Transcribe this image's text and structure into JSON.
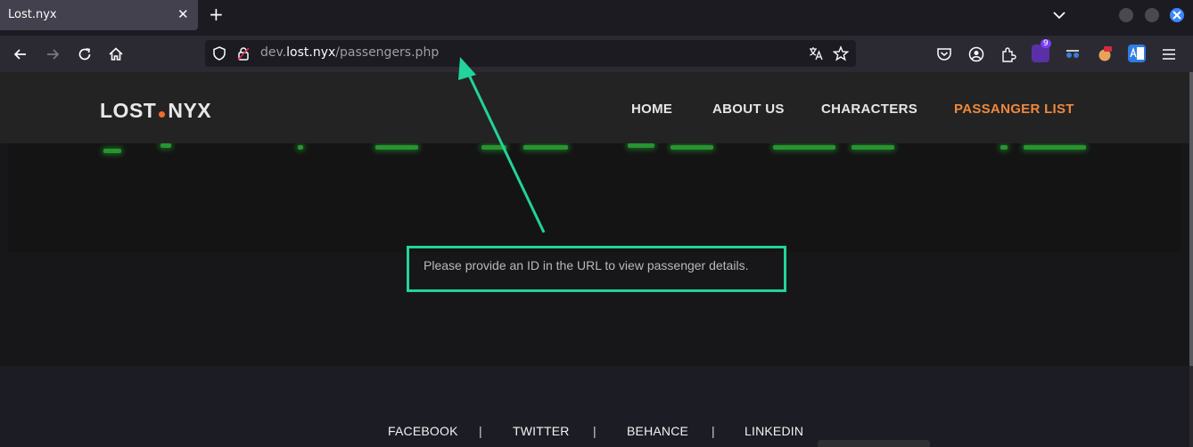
{
  "browser": {
    "tab_title": "Lost.nyx",
    "tab_close": "✕",
    "new_tab": "+",
    "url_host": "dev.lost.nyx",
    "url_host_prefix": "dev.",
    "url_host_main": "lost.nyx",
    "url_path": "/passengers.php",
    "extension_badge": "9"
  },
  "site": {
    "logo_left": "LOST",
    "logo_right": "NYX",
    "menu": [
      {
        "label": "HOME"
      },
      {
        "label": "ABOUT US"
      },
      {
        "label": "CHARACTERS"
      },
      {
        "label": "PASSANGER LIST",
        "active": true
      }
    ],
    "message": "Please provide an ID in the URL to view passenger details.",
    "footer_links": [
      "FACEBOOK",
      "TWITTER",
      "BEHANCE",
      "LINKEDIN"
    ],
    "footer_separator": "|"
  },
  "colors": {
    "accent_active_menu": "#f0883e",
    "logo_dot": "#f26b2b",
    "annotation": "#22d39a",
    "matrix_glow": "#2fbf3a"
  },
  "icons": [
    "back-icon",
    "forward-icon",
    "reload-icon",
    "home-icon",
    "shield-icon",
    "lock-icon",
    "translate-icon",
    "star-icon",
    "pocket-icon",
    "account-icon",
    "extensions-icon",
    "menu-icon"
  ]
}
